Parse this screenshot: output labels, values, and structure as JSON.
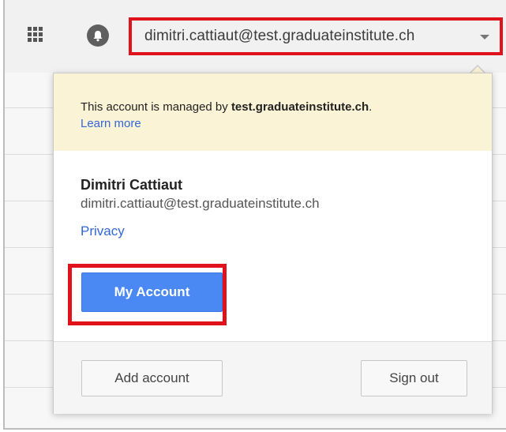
{
  "topbar": {
    "icons": {
      "apps": "apps-grid-icon",
      "notifications": "notifications-bell-icon",
      "caret": "caret-down-icon"
    },
    "account_email": "dimitri.cattiaut@test.graduateinstitute.ch"
  },
  "popup": {
    "notice": {
      "text_prefix": "This account is managed by ",
      "domain": "test.graduateinstitute.ch",
      "text_suffix": ".",
      "learn_more": "Learn more"
    },
    "profile": {
      "name": "Dimitri Cattiaut",
      "email": "dimitri.cattiaut@test.graduateinstitute.ch",
      "privacy_link": "Privacy"
    },
    "my_account_button": "My Account",
    "footer": {
      "add_account": "Add account",
      "sign_out": "Sign out"
    }
  },
  "colors": {
    "highlight": "#e0121b",
    "primary_button": "#4a89f3",
    "link": "#3367d6",
    "notice_background": "#fbf3d5"
  }
}
